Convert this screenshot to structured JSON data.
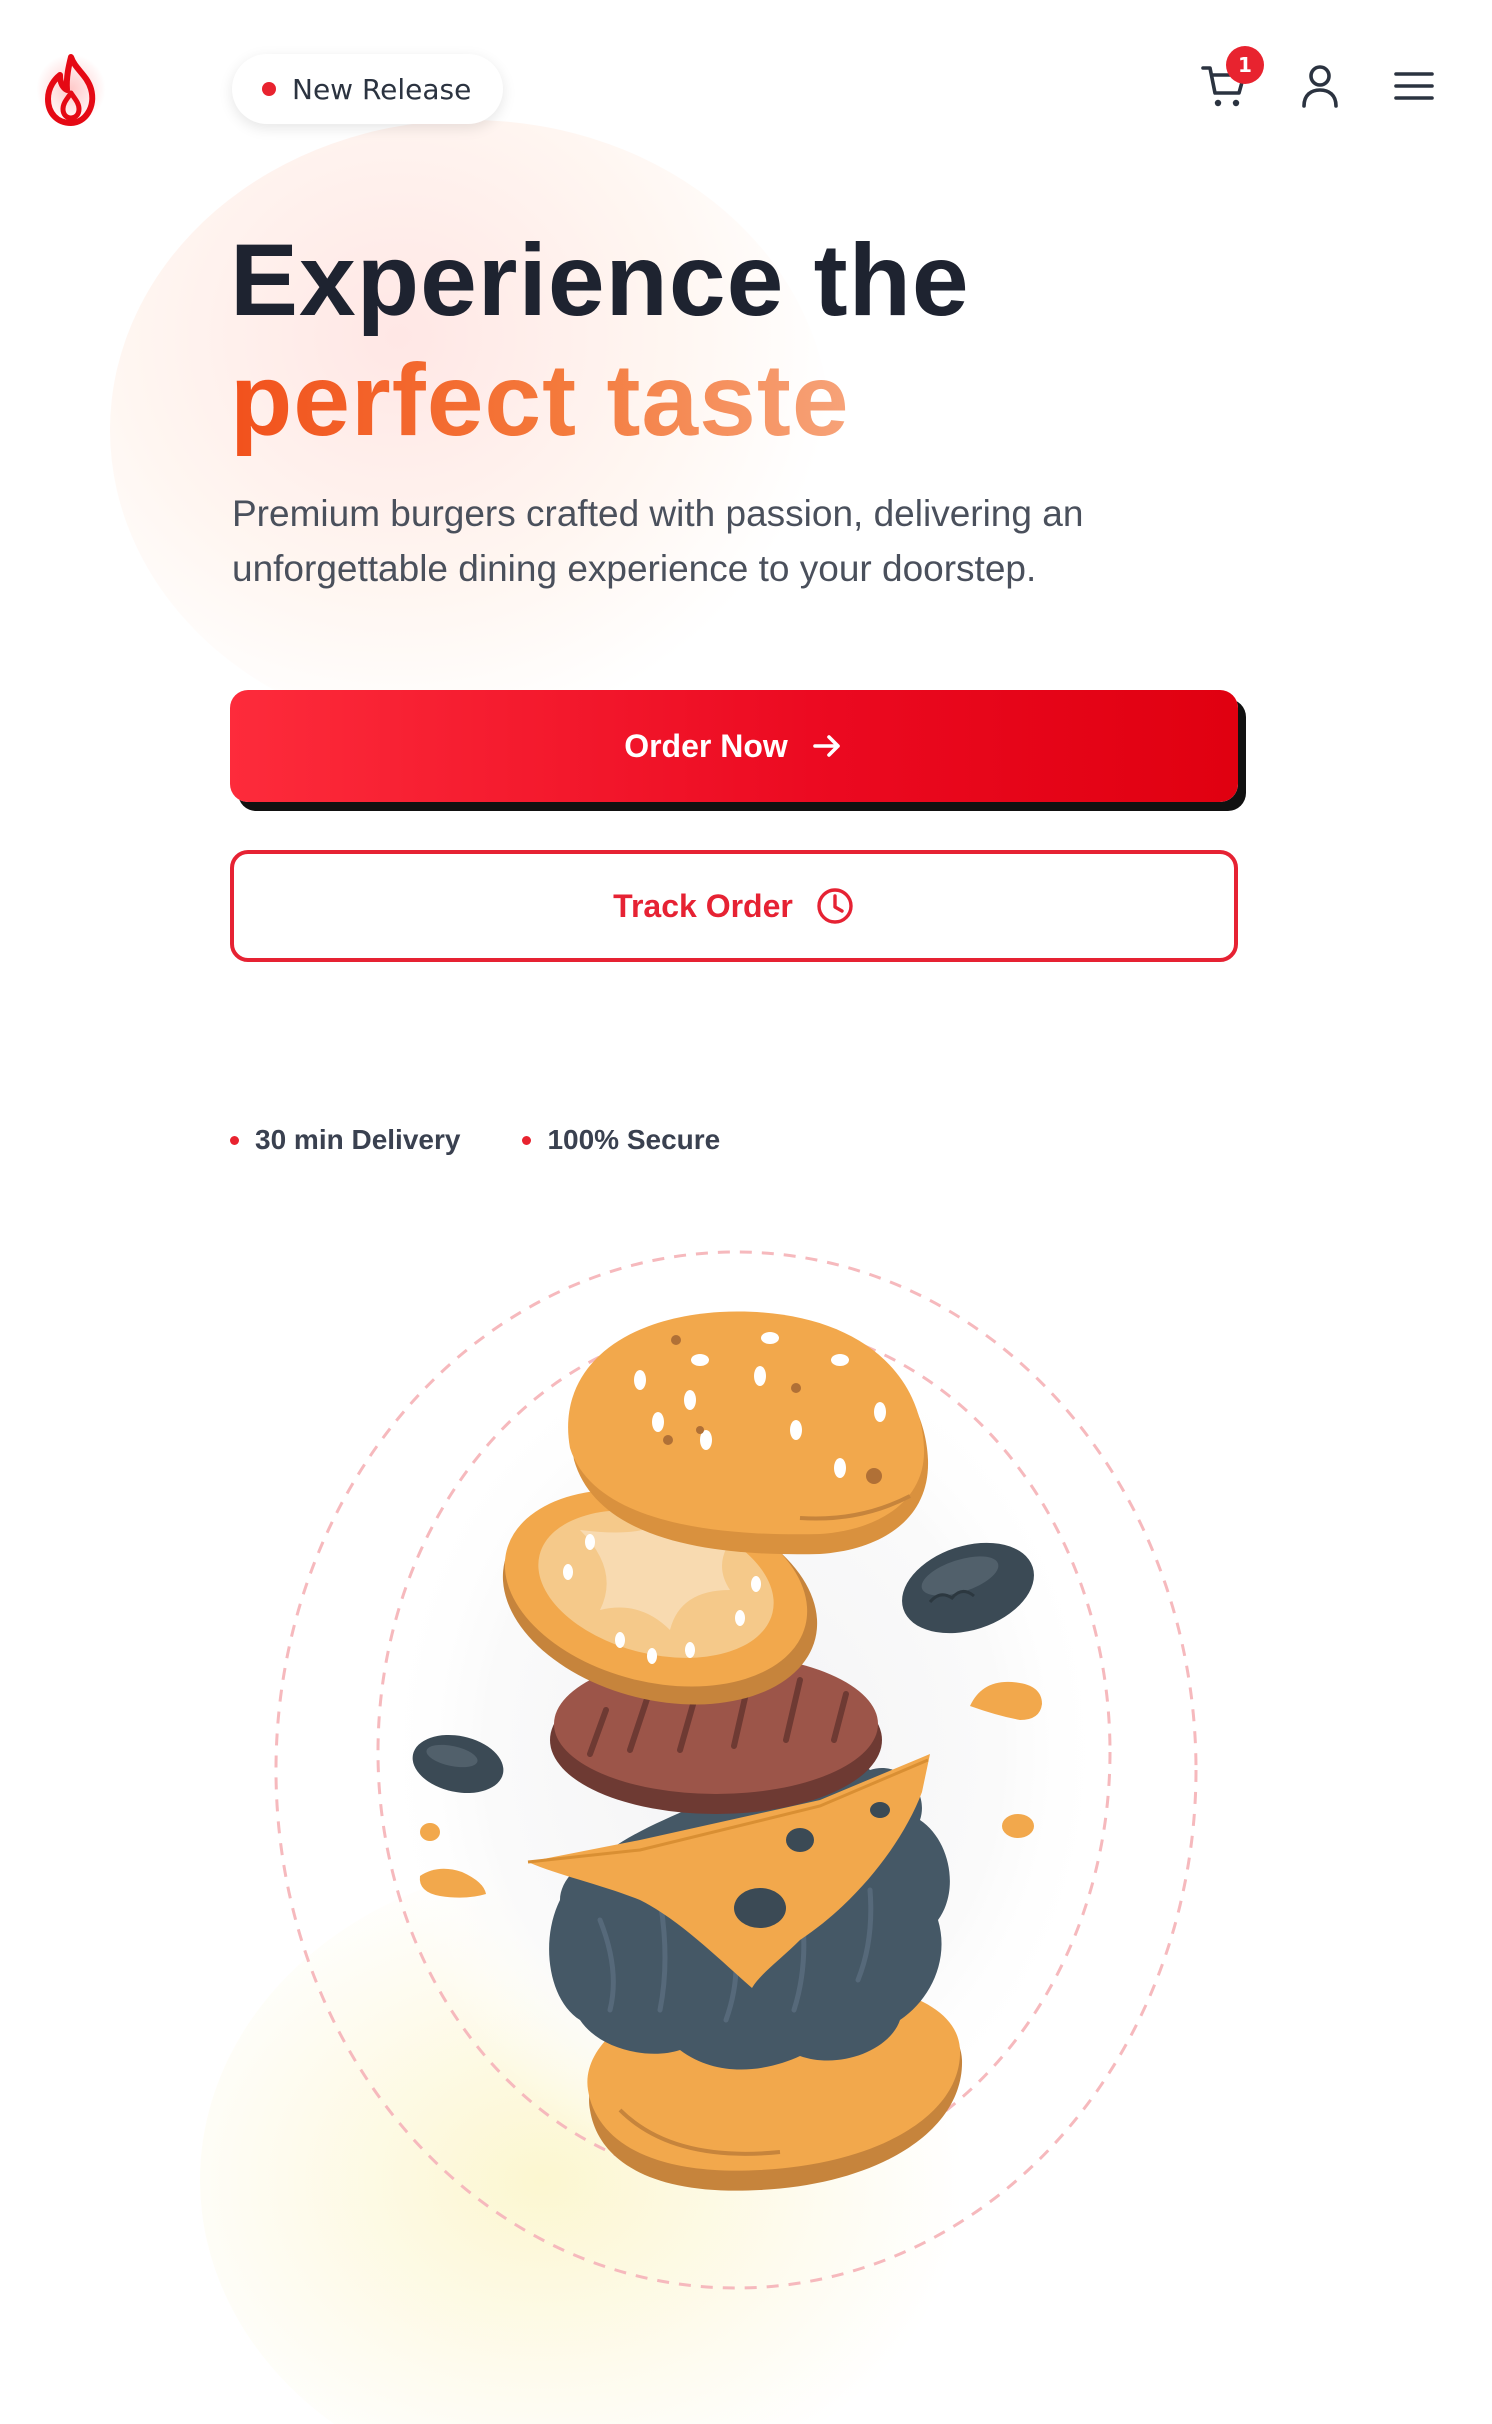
{
  "header": {
    "logo_icon": "flame-icon",
    "badge_label": "New Release",
    "cart_icon": "cart-icon",
    "cart_count": "1",
    "user_icon": "user-icon",
    "menu_icon": "menu-icon"
  },
  "hero": {
    "title_line1": "Experience the",
    "title_line2": "perfect taste",
    "subtitle": "Premium burgers crafted with passion, delivering an unforgettable dining experience to your doorstep."
  },
  "actions": {
    "order_label": "Order Now",
    "order_icon": "arrow-right-icon",
    "track_label": "Track Order",
    "track_icon": "clock-icon"
  },
  "features": [
    {
      "label": "30 min Delivery"
    },
    {
      "label": "100% Secure"
    }
  ],
  "colors": {
    "accent": "#e8232f",
    "headline_dark": "#1e2330",
    "headline_orange": "#f2511c",
    "body_text": "#4a505c"
  },
  "illustration": {
    "subject": "exploded-burger-illustration"
  }
}
